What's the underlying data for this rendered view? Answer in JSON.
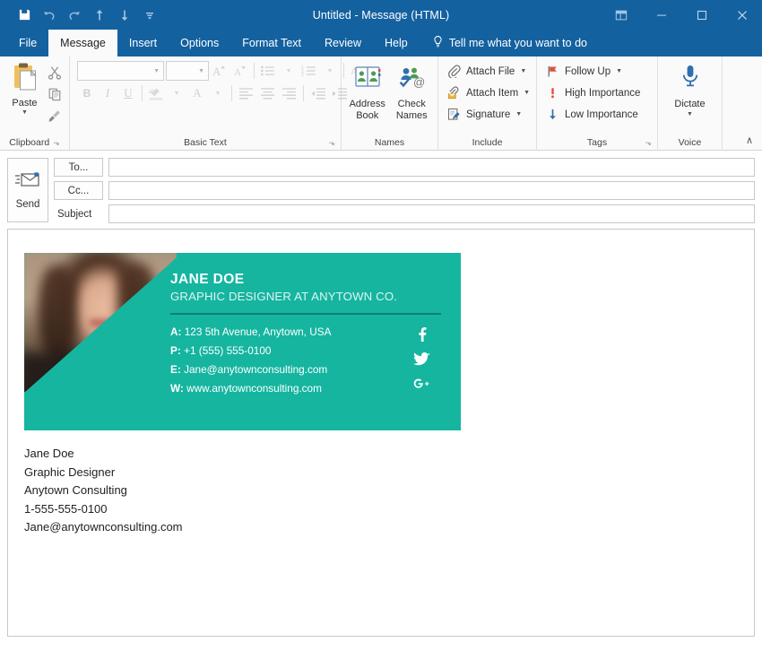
{
  "titlebar": {
    "title": "Untitled  -  Message (HTML)",
    "quick_access": [
      {
        "name": "save-icon",
        "label": "Save"
      },
      {
        "name": "undo-icon",
        "label": "Undo"
      },
      {
        "name": "redo-icon",
        "label": "Redo"
      },
      {
        "name": "previous-item-icon",
        "label": "Previous Item"
      },
      {
        "name": "next-item-icon",
        "label": "Next Item"
      },
      {
        "name": "customize-quick-access-toolbar-icon",
        "label": "Customize Quick Access Toolbar"
      }
    ],
    "window_controls": [
      {
        "name": "ribbon-display-options-icon",
        "label": "Ribbon Display Options"
      },
      {
        "name": "minimize-icon",
        "label": "Minimize"
      },
      {
        "name": "maximize-icon",
        "label": "Maximize"
      },
      {
        "name": "close-icon",
        "label": "Close"
      }
    ]
  },
  "tabs": [
    {
      "label": "File",
      "active": false
    },
    {
      "label": "Message",
      "active": true
    },
    {
      "label": "Insert",
      "active": false
    },
    {
      "label": "Options",
      "active": false
    },
    {
      "label": "Format Text",
      "active": false
    },
    {
      "label": "Review",
      "active": false
    },
    {
      "label": "Help",
      "active": false
    }
  ],
  "tell_me": {
    "label": "Tell me what you want to do",
    "icon": "lightbulb-icon"
  },
  "ribbon": {
    "clipboard": {
      "group_label": "Clipboard",
      "paste_label": "Paste",
      "cut_label": "Cut",
      "copy_label": "Copy",
      "format_painter_label": "Format Painter",
      "dialog_launcher": "⬎"
    },
    "basic_text": {
      "group_label": "Basic Text",
      "font_name": "",
      "font_name_placeholder": "",
      "font_size": "",
      "font_size_placeholder": "",
      "grow_font_label": "Increase Font Size",
      "shrink_font_label": "Decrease Font Size",
      "bullets_label": "Bullets",
      "numbering_label": "Numbering",
      "clear_formatting_label": "Clear All Formatting",
      "bold_label": "B",
      "italic_label": "I",
      "underline_label": "U",
      "highlight_label": "Text Highlight Color",
      "font_color_label": "A",
      "align_left_label": "Align Left",
      "align_center_label": "Center",
      "align_right_label": "Align Right",
      "decrease_indent_label": "Decrease Indent",
      "increase_indent_label": "Increase Indent",
      "dialog_launcher": "⬎"
    },
    "names": {
      "group_label": "Names",
      "address_book_label": "Address Book",
      "check_names_label": "Check Names"
    },
    "include": {
      "group_label": "Include",
      "items": [
        {
          "label": "Attach File",
          "icon": "paperclip-icon",
          "has_caret": true
        },
        {
          "label": "Attach Item",
          "icon": "attach-item-icon",
          "has_caret": true
        },
        {
          "label": "Signature",
          "icon": "signature-icon",
          "has_caret": true
        }
      ]
    },
    "tags": {
      "group_label": "Tags",
      "items": [
        {
          "label": "Follow Up",
          "icon": "flag-icon",
          "has_caret": true
        },
        {
          "label": "High Importance",
          "icon": "exclamation-icon",
          "has_caret": false
        },
        {
          "label": "Low Importance",
          "icon": "down-arrow-icon",
          "has_caret": false
        }
      ],
      "dialog_launcher": "⬎"
    },
    "voice": {
      "group_label": "Voice",
      "dictate_label": "Dictate",
      "dictate_icon": "microphone-icon"
    },
    "collapse_label": "∧"
  },
  "compose": {
    "send_label": "Send",
    "send_icon": "send-envelope-icon",
    "to_button_label": "To...",
    "cc_button_label": "Cc...",
    "subject_label": "Subject",
    "to_value": "",
    "cc_value": "",
    "subject_value": "",
    "to_placeholder": "",
    "cc_placeholder": "",
    "subject_placeholder": ""
  },
  "signature_card": {
    "name": "JANE DOE",
    "role": "GRAPHIC DESIGNER AT ANYTOWN CO.",
    "brand_color": "#15B5A0",
    "rule_color": "#0E7F72",
    "rows": [
      {
        "prefix": "A:",
        "value": "123 5th Avenue, Anytown, USA"
      },
      {
        "prefix": "P:",
        "value": "+1 (555) 555-0100"
      },
      {
        "prefix": "E:",
        "value": "Jane@anytownconsulting.com"
      },
      {
        "prefix": "W:",
        "value": "www.anytownconsulting.com"
      }
    ],
    "social": [
      {
        "name": "facebook-icon",
        "glyph": "f"
      },
      {
        "name": "twitter-icon",
        "glyph": "t"
      },
      {
        "name": "google-plus-icon",
        "glyph": "G+"
      }
    ],
    "photo_alt": "portrait-photo"
  },
  "signature_text": {
    "lines": [
      "Jane Doe",
      "Graphic Designer",
      "Anytown Consulting",
      "1-555-555-0100",
      "Jane@anytownconsulting.com"
    ]
  }
}
